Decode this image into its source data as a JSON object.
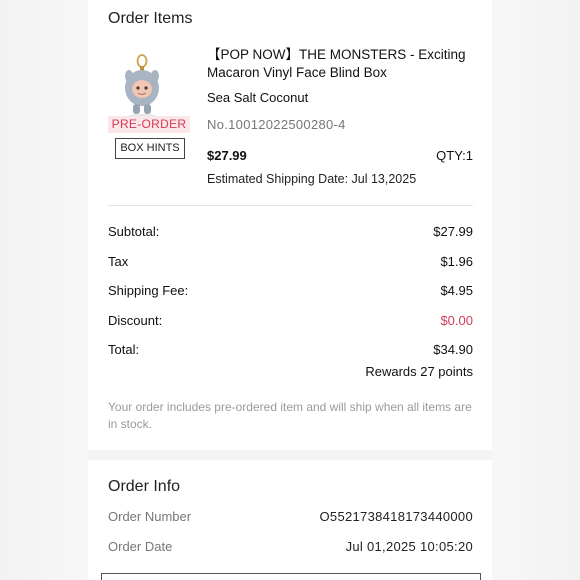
{
  "order_items": {
    "title": "Order Items",
    "product": {
      "badge": "PRE-ORDER",
      "box_hints": "BOX HINTS",
      "name": "【POP NOW】THE MONSTERS - Exciting Macaron Vinyl Face Blind Box",
      "variant": "Sea Salt Coconut",
      "sku": "No.10012022500280-4",
      "price": "$27.99",
      "qty": "QTY:1",
      "shipping_date": "Estimated Shipping Date: Jul 13,2025",
      "thumbnail_icon": "figure-keychain-icon"
    }
  },
  "summary": {
    "rows": [
      {
        "label": "Subtotal:",
        "value": "$27.99"
      },
      {
        "label": "Tax",
        "value": "$1.96"
      },
      {
        "label": "Shipping Fee:",
        "value": "$4.95"
      },
      {
        "label": "Discount:",
        "value": "$0.00"
      },
      {
        "label": "Total:",
        "value": "$34.90"
      }
    ],
    "rewards": "Rewards 27 points",
    "note": "Your order includes pre-ordered item and will ship when all items are in stock."
  },
  "order_info": {
    "title": "Order Info",
    "rows": [
      {
        "label": "Order Number",
        "value": "O5521738418173440000"
      },
      {
        "label": "Order Date",
        "value": "Jul 01,2025 10:05:20"
      }
    ]
  },
  "colors": {
    "accent": "#d43a57",
    "badge_bg": "#fbe6ea",
    "muted": "#9a9a9a"
  }
}
